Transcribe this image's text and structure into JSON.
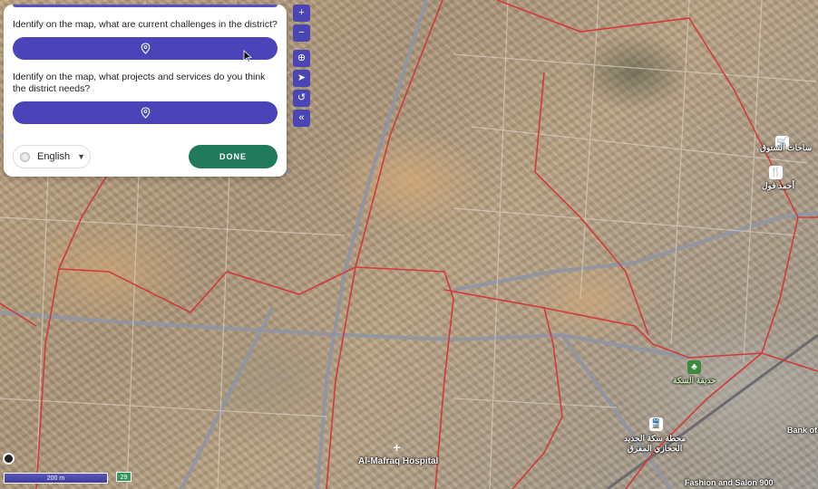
{
  "survey": {
    "questions": [
      {
        "text": "Identify on the map, what are current challenges in the district?",
        "pin_icon": "map-pin-icon"
      },
      {
        "text": "Identify on the map, what projects and services do you think the district needs?",
        "pin_icon": "map-pin-icon"
      }
    ],
    "language": {
      "value": "English",
      "icon": "globe-icon"
    },
    "done_label": "DONE",
    "accent_color": "#4a44b8",
    "done_color": "#227a5c"
  },
  "map_controls": {
    "zoom_in": "+",
    "zoom_out": "−",
    "tools": [
      "zoom-area-icon",
      "navigate-icon",
      "undo-icon",
      "collapse-icon"
    ]
  },
  "map": {
    "labels": {
      "hospital": "Al-Mafraq Hospital",
      "fashion": "Fashion and Salon 900",
      "bank": "Bank of",
      "railway": "محطة سكة الحديد\nالحجازي المفرق",
      "park": "حديقة السكة",
      "market": "ساحات الستوق",
      "food": "أحمد فول"
    },
    "boundary_color": "#d23a3a"
  },
  "scale": {
    "label": "200 m"
  },
  "zoom_level": "29"
}
